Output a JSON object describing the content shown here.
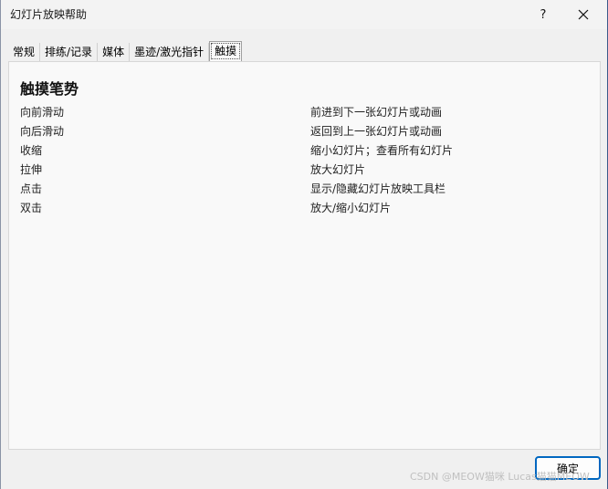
{
  "window": {
    "title": "幻灯片放映帮助",
    "help_label": "?"
  },
  "tabs": [
    {
      "label": "常规"
    },
    {
      "label": "排练/记录"
    },
    {
      "label": "媒体"
    },
    {
      "label": "墨迹/激光指针"
    },
    {
      "label": "触摸",
      "active": true
    }
  ],
  "panel": {
    "heading": "触摸笔势",
    "gestures": [
      {
        "gesture": "向前滑动",
        "description": "前进到下一张幻灯片或动画"
      },
      {
        "gesture": "向后滑动",
        "description": "返回到上一张幻灯片或动画"
      },
      {
        "gesture": "收缩",
        "description": "缩小幻灯片；查看所有幻灯片"
      },
      {
        "gesture": "拉伸",
        "description": "放大幻灯片"
      },
      {
        "gesture": "点击",
        "description": "显示/隐藏幻灯片放映工具栏"
      },
      {
        "gesture": "双击",
        "description": "放大/缩小幻灯片"
      }
    ]
  },
  "footer": {
    "ok_label": "确定",
    "watermark": "CSDN @MEOW猫咪 Lucas猫猫MEOW"
  }
}
